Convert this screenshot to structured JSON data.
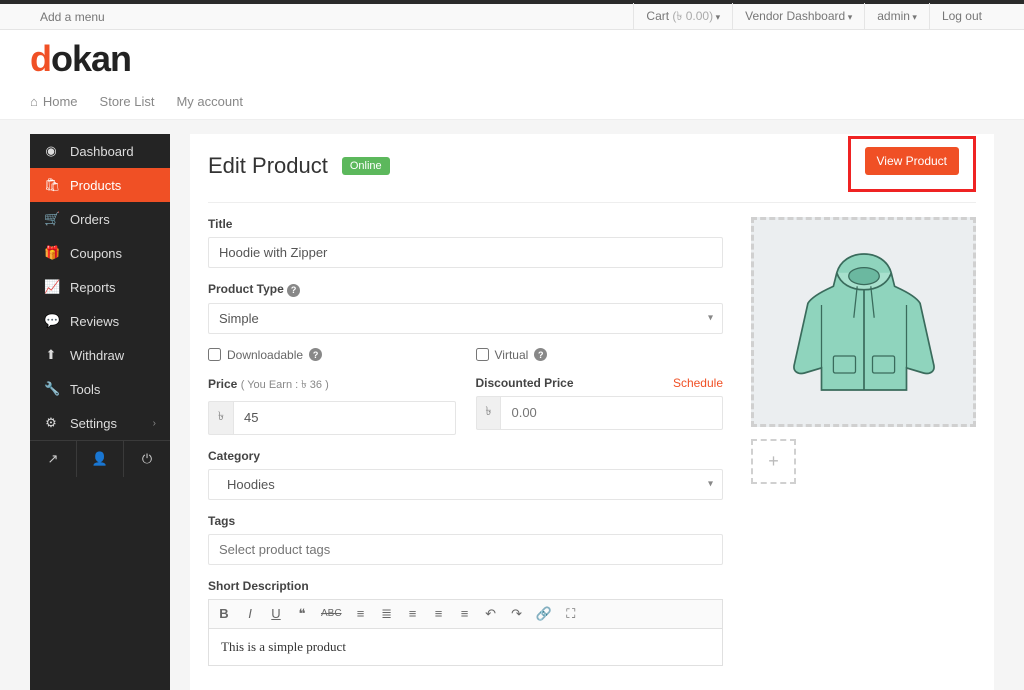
{
  "topbar": {
    "add_menu": "Add a menu",
    "cart_label": "Cart",
    "cart_amount": "(৳ 0.00)",
    "vendor": "Vendor Dashboard",
    "admin": "admin",
    "logout": "Log out"
  },
  "logo": {
    "d": "d",
    "rest": "okan"
  },
  "nav": {
    "home": "Home",
    "store_list": "Store List",
    "account": "My account"
  },
  "sidebar": {
    "items": [
      {
        "label": "Dashboard"
      },
      {
        "label": "Products"
      },
      {
        "label": "Orders"
      },
      {
        "label": "Coupons"
      },
      {
        "label": "Reports"
      },
      {
        "label": "Reviews"
      },
      {
        "label": "Withdraw"
      },
      {
        "label": "Tools"
      },
      {
        "label": "Settings"
      }
    ]
  },
  "page": {
    "title": "Edit Product",
    "status": "Online",
    "view_btn": "View Product"
  },
  "form": {
    "title_label": "Title",
    "title_value": "Hoodie with Zipper",
    "type_label": "Product Type",
    "type_value": "Simple",
    "downloadable": "Downloadable",
    "virtual": "Virtual",
    "price_label": "Price",
    "price_hint": "( You Earn : ৳  36 )",
    "price_currency": "৳",
    "price_value": "45",
    "discount_label": "Discounted Price",
    "discount_placeholder": "0.00",
    "schedule": "Schedule",
    "category_label": "Category",
    "category_value": "Hoodies",
    "tags_label": "Tags",
    "tags_placeholder": "Select product tags",
    "short_desc_label": "Short Description",
    "short_desc_value": "This is a simple product"
  }
}
